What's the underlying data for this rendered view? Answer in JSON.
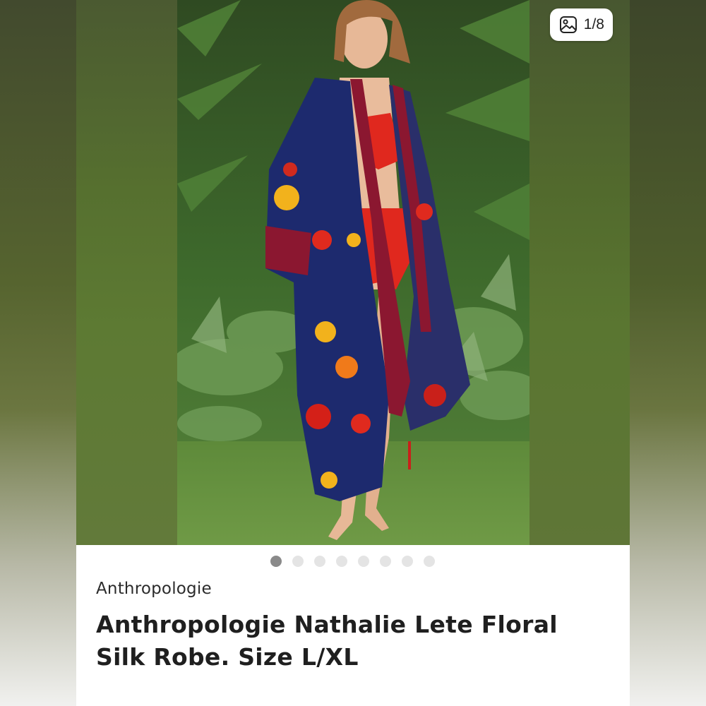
{
  "listing": {
    "image_counter": "1/8",
    "image_counter_icon": "image-gallery-icon",
    "carousel": {
      "total": 8,
      "active_index": 0
    },
    "brand": "Anthropologie",
    "title": "Anthropologie Nathalie Lete Floral Silk Robe. Size L/XL"
  },
  "colors": {
    "accent_dot_active": "#8a8a8a",
    "dot_inactive": "#e4e4e4",
    "robe_navy": "#1d2a6e",
    "robe_trim": "#8b1730",
    "swimsuit_red": "#e0281e"
  }
}
